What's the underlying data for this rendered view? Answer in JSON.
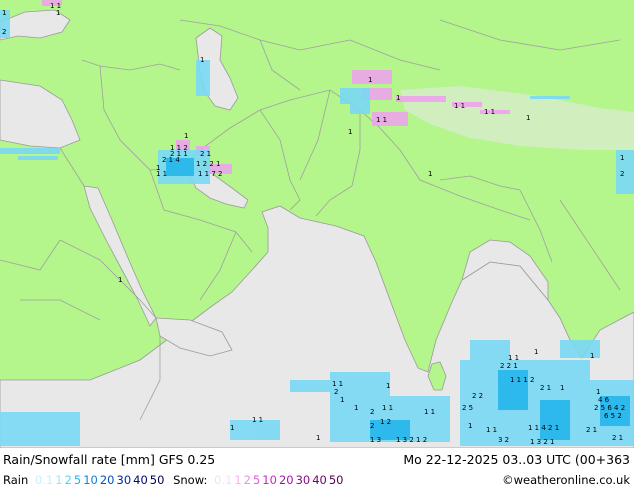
{
  "header": {
    "title": "Rain/Snowfall rate [mm] GFS 0.25",
    "datetime": "Mo 22-12-2025 03..03 UTC (00+363"
  },
  "legend": {
    "rain_label": "Rain",
    "rain_steps": [
      {
        "label": "0.1",
        "color": "#c8f0ff"
      },
      {
        "label": "1",
        "color": "#96e6ff"
      },
      {
        "label": "2",
        "color": "#50d2f5"
      },
      {
        "label": "5",
        "color": "#1eb4eb"
      },
      {
        "label": "10",
        "color": "#0a82dc"
      },
      {
        "label": "20",
        "color": "#0050c8"
      },
      {
        "label": "30",
        "color": "#0028a0"
      },
      {
        "label": "40",
        "color": "#000a6e"
      },
      {
        "label": "50",
        "color": "#000050"
      }
    ],
    "snow_label": "Snow:",
    "snow_steps": [
      {
        "label": "0.1",
        "color": "#fadcfa"
      },
      {
        "label": "1",
        "color": "#f5b4f0"
      },
      {
        "label": "2",
        "color": "#eb8ce6"
      },
      {
        "label": "5",
        "color": "#dc5ad7"
      },
      {
        "label": "10",
        "color": "#c828c3"
      },
      {
        "label": "20",
        "color": "#aa14a5"
      },
      {
        "label": "30",
        "color": "#8c0a87"
      },
      {
        "label": "40",
        "color": "#6e006e"
      },
      {
        "label": "50",
        "color": "#500050"
      }
    ]
  },
  "credit": "©weatheronline.co.uk",
  "colors": {
    "land": "#b4f58c",
    "sea": "#e8e8e8",
    "border": "#a0a0a0",
    "rain": "#50d2f5",
    "snow": "#f0a0f0"
  }
}
